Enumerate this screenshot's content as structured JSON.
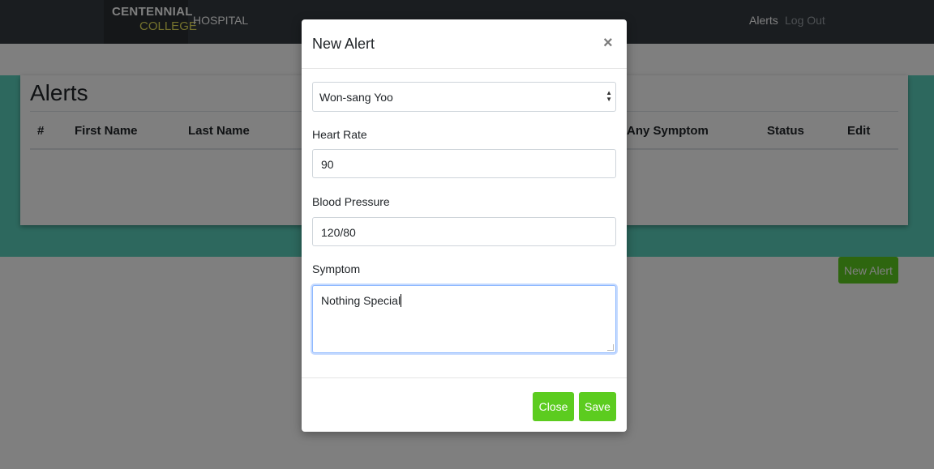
{
  "navbar": {
    "logo_line1": "CENTENNIAL",
    "logo_line2": "COLLEGE",
    "brand": "HOSPITAL",
    "links": {
      "alerts": "Alerts",
      "logout": "Log Out"
    }
  },
  "page": {
    "title": "Alerts",
    "columns": [
      "#",
      "First Name",
      "Last Name",
      "",
      "Any Symptom",
      "Status",
      "Edit"
    ],
    "new_alert_button": "New Alert"
  },
  "modal": {
    "title": "New Alert",
    "close_icon": "×",
    "patient_select": {
      "value": "Won-sang Yoo"
    },
    "heart_rate": {
      "label": "Heart Rate",
      "value": "90"
    },
    "blood_pressure": {
      "label": "Blood Pressure",
      "value": "120/80"
    },
    "symptom": {
      "label": "Symptom",
      "value": "Nothing Special"
    },
    "buttons": {
      "close": "Close",
      "save": "Save"
    }
  },
  "colors": {
    "navbar": "#343a40",
    "teal_band": "#5bd1bd",
    "accent_green": "#5ccc1f"
  }
}
